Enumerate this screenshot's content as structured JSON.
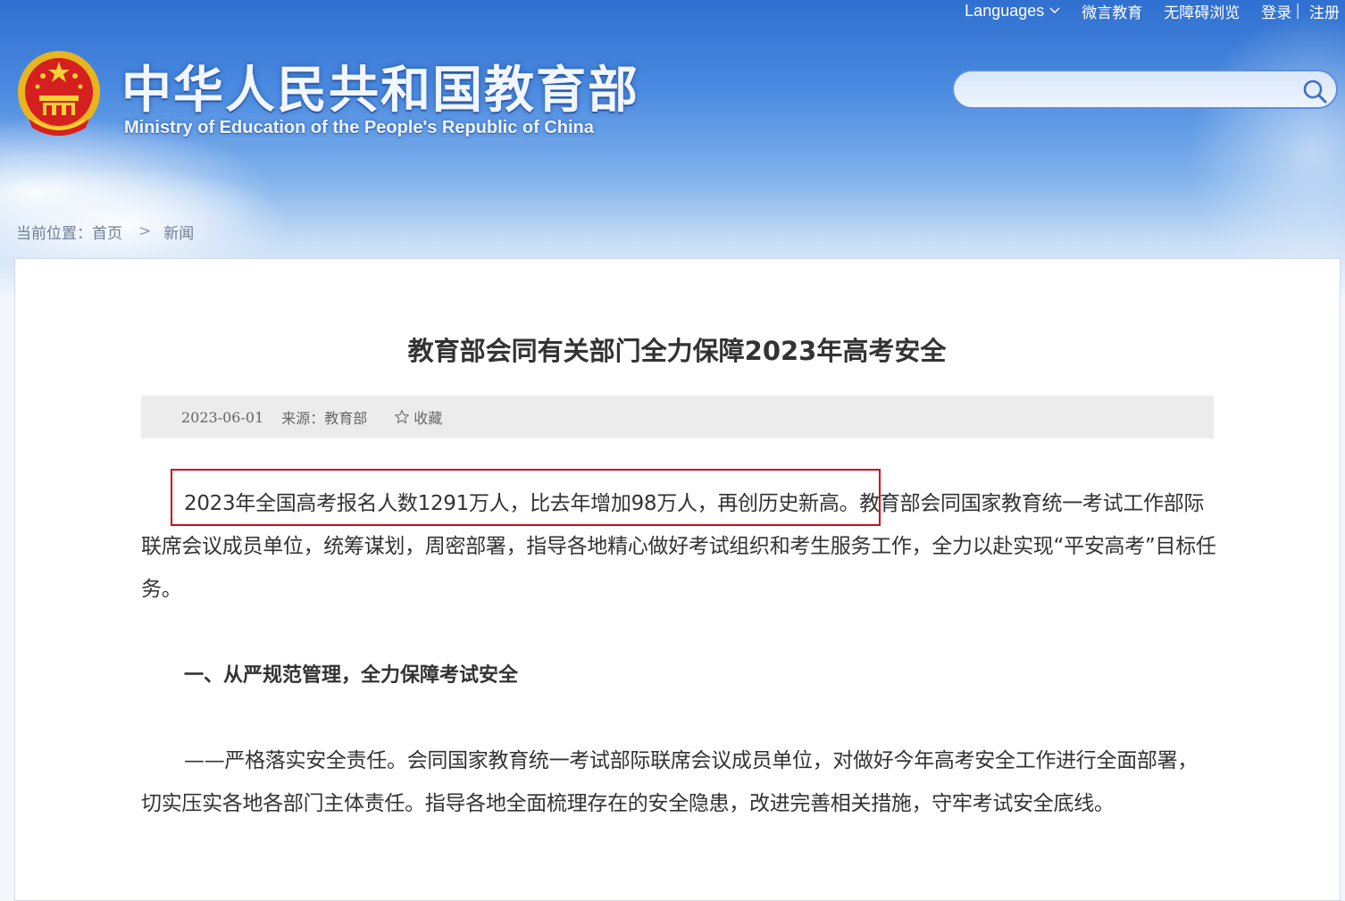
{
  "header": {
    "title_cn": "中华人民共和国教育部",
    "title_en": "Ministry of Education of the People's Republic of China",
    "emblem_icon": "national-emblem-icon"
  },
  "top_links": {
    "languages": "Languages",
    "weiyan": "微言教育",
    "accessible": "无障碍浏览",
    "login": "登录",
    "separator": "|",
    "register": "注册"
  },
  "search": {
    "placeholder": "",
    "icon": "search-icon"
  },
  "breadcrumb": {
    "prefix": "当前位置：",
    "home": "首页",
    "arrow": ">",
    "current": "新闻"
  },
  "article": {
    "title": "教育部会同有关部门全力保障2023年高考安全",
    "date": "2023-06-01",
    "source": "来源：教育部",
    "favorite": "收藏",
    "para1_highlight": "2023年全国高考报名人数1291万人，比去年增加98万人，再创历史新高。",
    "para1_rest": "教育部会同国家教育统一考试工作部际联席会议成员单位，统筹谋划，周密部署，指导各地精心做好考试组织和考生服务工作，全力以赴实现“平安高考”目标任务。",
    "subhead1": "一、从严规范管理，全力保障考试安全",
    "para2": "——严格落实安全责任。会同国家教育统一考试部际联席会议成员单位，对做好今年高考安全工作进行全面部署，切实压实各地各部门主体责任。指导各地全面梳理存在的安全隐患，改进完善相关措施，守牢考试安全底线。"
  },
  "colors": {
    "highlight_border": "#c8101e",
    "sky_blue": "#4a8ae0",
    "meta_bg": "#ececec"
  }
}
